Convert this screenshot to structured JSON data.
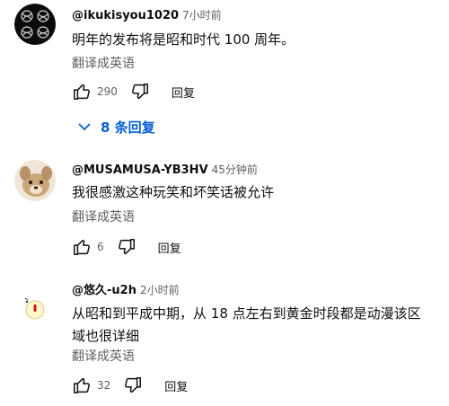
{
  "comments": [
    {
      "author": "@ikukisyou1020",
      "time": "7小时前",
      "text": "明年的发布将是昭和时代 100 周年。",
      "translate_label": "翻译成英语",
      "likes": "290",
      "reply_label": "回复",
      "replies_toggle": "8 条回复"
    },
    {
      "author": "@MUSAMUSA-YB3HV",
      "time": "45分钟前",
      "text": "我很感激这种玩笑和坏笑话被允许",
      "translate_label": "翻译成英语",
      "likes": "6",
      "reply_label": "回复"
    },
    {
      "author": "@悠久-u2h",
      "time": "2小时前",
      "text": "从昭和到平成中期，从 18 点左右到黄金时段都是动漫该区域也很详细",
      "translate_label": "翻译成英语",
      "likes": "32",
      "reply_label": "回复"
    }
  ],
  "colors": {
    "link": "#065fd4",
    "secondary": "#606060",
    "text": "#0f0f0f"
  },
  "icons": [
    "like-icon",
    "dislike-icon",
    "chevron-down-icon"
  ]
}
